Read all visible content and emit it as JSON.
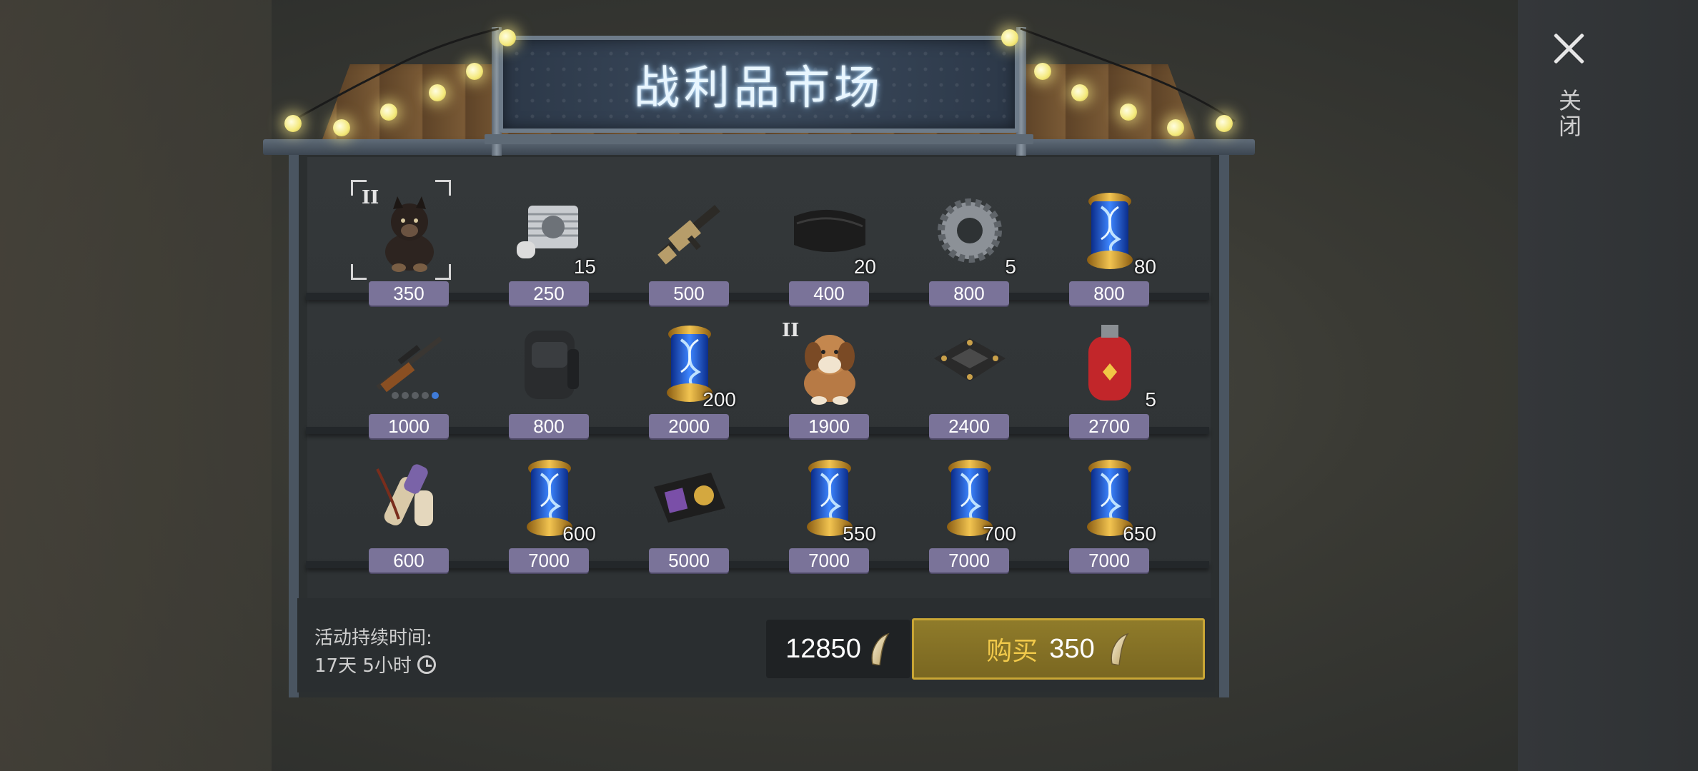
{
  "market": {
    "title": "战利品市场",
    "close_label": "关闭"
  },
  "items": [
    {
      "kind": "dog-black-icon",
      "tier": "II",
      "qty": "",
      "price": "350",
      "selected": true
    },
    {
      "kind": "engine-part-icon",
      "tier": "",
      "qty": "15",
      "price": "250"
    },
    {
      "kind": "rifle-icon",
      "tier": "",
      "qty": "",
      "price": "500"
    },
    {
      "kind": "leather-icon",
      "tier": "",
      "qty": "20",
      "price": "400"
    },
    {
      "kind": "gear-icon",
      "tier": "",
      "qty": "5",
      "price": "800"
    },
    {
      "kind": "dna-capsule-icon",
      "tier": "",
      "qty": "80",
      "price": "800"
    },
    {
      "kind": "sniper-rifle-icon",
      "tier": "",
      "qty": "",
      "price": "1000"
    },
    {
      "kind": "backpack-icon",
      "tier": "",
      "qty": "",
      "price": "800"
    },
    {
      "kind": "dna-capsule-icon",
      "tier": "",
      "qty": "200",
      "price": "2000"
    },
    {
      "kind": "dog-brown-icon",
      "tier": "II",
      "qty": "",
      "price": "1900"
    },
    {
      "kind": "circuit-board-icon",
      "tier": "",
      "qty": "",
      "price": "2400"
    },
    {
      "kind": "gas-tank-icon",
      "tier": "",
      "qty": "5",
      "price": "2700"
    },
    {
      "kind": "scroll-icon",
      "tier": "",
      "qty": "",
      "price": "600"
    },
    {
      "kind": "dna-capsule-icon",
      "tier": "",
      "qty": "600",
      "price": "7000"
    },
    {
      "kind": "badge-wallet-icon",
      "tier": "",
      "qty": "",
      "price": "5000"
    },
    {
      "kind": "dna-capsule-icon",
      "tier": "",
      "qty": "550",
      "price": "7000"
    },
    {
      "kind": "dna-capsule-icon",
      "tier": "",
      "qty": "700",
      "price": "7000"
    },
    {
      "kind": "dna-capsule-icon",
      "tier": "",
      "qty": "650",
      "price": "7000"
    }
  ],
  "footer": {
    "duration_label": "活动持续时间:",
    "duration_value": "17天 5小时",
    "balance": "12850",
    "buy_label": "购买",
    "buy_price": "350"
  },
  "colors": {
    "price_tag": "#7a7399",
    "buy_button": "#8f7b2a",
    "buy_text": "#f1c94a",
    "dna_blue": "#2a63d8",
    "capsule_gold": "#d8a437"
  }
}
